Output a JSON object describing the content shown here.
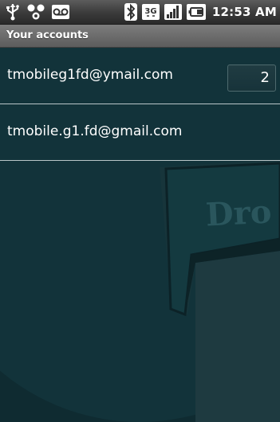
{
  "status_bar": {
    "time": "12:53 AM",
    "left_icons": [
      "usb-icon",
      "sync-icon",
      "voicemail-icon"
    ],
    "right_icons": [
      "bluetooth-icon",
      "3g-icon",
      "signal-icon",
      "battery-icon"
    ]
  },
  "title_bar": {
    "title": "Your accounts"
  },
  "accounts": [
    {
      "email": "tmobileg1fd@ymail.com",
      "unread_count": "2"
    },
    {
      "email": "tmobile.g1.fd@gmail.com"
    }
  ],
  "background": {
    "watermark_text": "Dro"
  }
}
